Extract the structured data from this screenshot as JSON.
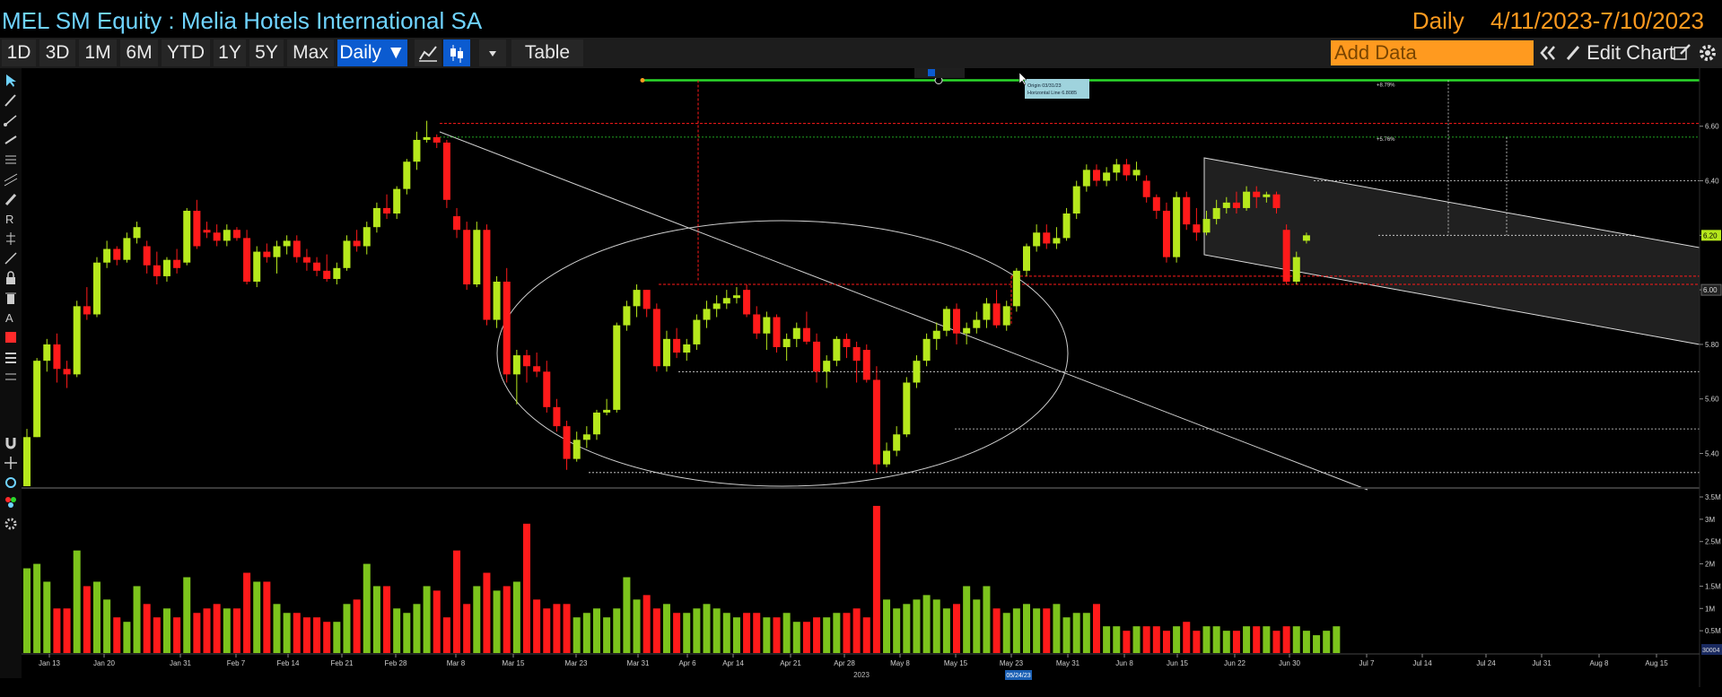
{
  "window": {
    "title": "MEL SM Equity : Melia Hotels International SA",
    "frequency": "Daily",
    "date_range": "4/11/2023-7/10/2023"
  },
  "toolbar": {
    "periods": [
      "1D",
      "3D",
      "1M",
      "6M",
      "YTD",
      "1Y",
      "5Y",
      "Max"
    ],
    "frequency_label": "Daily ▼",
    "table_label": "Table",
    "add_data_placeholder": "Add Data",
    "edit_chart_label": "Edit Chart",
    "icons": [
      "line-chart-icon",
      "candlestick-icon",
      "dropdown-icon",
      "collapse-icon",
      "pencil-icon",
      "edit-icon",
      "gear-icon"
    ]
  },
  "left_toolbar": {
    "icons": [
      "pointer-icon",
      "pencil-icon",
      "trend-line-icon",
      "ray-icon",
      "fib-icon",
      "channel-icon",
      "brush-icon",
      "text-icon",
      "measure-icon",
      "eraser-icon",
      "lock-icon",
      "trash-icon",
      "color-icon",
      "style-icon",
      "settings-icon"
    ],
    "accent": "#ff2a2a"
  },
  "annotations": {
    "tooltip": [
      "Origin 03/31/23",
      "Horizontal Line 6.8085"
    ],
    "pct_labels": [
      "+8.79%",
      "+5.76%"
    ],
    "year_label": "2023",
    "cursor_date": "05/24/23"
  },
  "chart_data": {
    "type": "candlestick",
    "colors": {
      "up": "#b6e81c",
      "down": "#ff1a1a",
      "volume_up": "#7cc41c",
      "volume_down": "#ff1a1a",
      "level_green": "#2bd92b"
    },
    "price_axis": {
      "ticks": [
        "6.60",
        "6.40",
        "6.20",
        "6.00",
        "5.80",
        "5.60",
        "5.40"
      ],
      "ylim": [
        5.28,
        6.78
      ],
      "last_price": "6.20",
      "marker": "6.00"
    },
    "volume_axis": {
      "ticks": [
        "3.5M",
        "3M",
        "2.5M",
        "2M",
        "1.5M",
        "1M",
        "0.5M"
      ],
      "ylim": [
        0,
        3.5
      ],
      "last_volume": "30004"
    },
    "x_ticks": [
      "Jan 13",
      "Jan 20",
      "Jan 31",
      "Feb 7",
      "Feb 14",
      "Feb 21",
      "Feb 28",
      "Mar 8",
      "Mar 15",
      "Mar 23",
      "Mar 31",
      "Apr 6",
      "Apr 14",
      "Apr 21",
      "Apr 28",
      "May 8",
      "May 15",
      "May 23",
      "May 31",
      "Jun 8",
      "Jun 15",
      "Jun 22",
      "Jun 30",
      "Jul 7",
      "Jul 14",
      "Jul 24",
      "Jul 31",
      "Aug 8",
      "Aug 15"
    ],
    "ohlc": [
      {
        "o": 5.28,
        "h": 5.49,
        "l": 5.28,
        "c": 5.46
      },
      {
        "o": 5.46,
        "h": 5.75,
        "l": 5.46,
        "c": 5.74
      },
      {
        "o": 5.74,
        "h": 5.82,
        "l": 5.7,
        "c": 5.8
      },
      {
        "o": 5.8,
        "h": 5.84,
        "l": 5.66,
        "c": 5.71
      },
      {
        "o": 5.71,
        "h": 5.74,
        "l": 5.64,
        "c": 5.69
      },
      {
        "o": 5.69,
        "h": 5.96,
        "l": 5.68,
        "c": 5.94
      },
      {
        "o": 5.94,
        "h": 6.01,
        "l": 5.89,
        "c": 5.91
      },
      {
        "o": 5.91,
        "h": 6.12,
        "l": 5.9,
        "c": 6.1
      },
      {
        "o": 6.1,
        "h": 6.18,
        "l": 6.08,
        "c": 6.15
      },
      {
        "o": 6.15,
        "h": 6.16,
        "l": 6.09,
        "c": 6.11
      },
      {
        "o": 6.11,
        "h": 6.21,
        "l": 6.1,
        "c": 6.19
      },
      {
        "o": 6.19,
        "h": 6.25,
        "l": 6.17,
        "c": 6.23
      },
      {
        "o": 6.16,
        "h": 6.18,
        "l": 6.06,
        "c": 6.09
      },
      {
        "o": 6.09,
        "h": 6.14,
        "l": 6.02,
        "c": 6.05
      },
      {
        "o": 6.05,
        "h": 6.12,
        "l": 6.03,
        "c": 6.11
      },
      {
        "o": 6.11,
        "h": 6.15,
        "l": 6.06,
        "c": 6.08
      },
      {
        "o": 6.1,
        "h": 6.3,
        "l": 6.09,
        "c": 6.29
      },
      {
        "o": 6.29,
        "h": 6.33,
        "l": 6.15,
        "c": 6.16
      },
      {
        "o": 6.22,
        "h": 6.25,
        "l": 6.19,
        "c": 6.21
      },
      {
        "o": 6.21,
        "h": 6.24,
        "l": 6.16,
        "c": 6.18
      },
      {
        "o": 6.18,
        "h": 6.24,
        "l": 6.16,
        "c": 6.22
      },
      {
        "o": 6.22,
        "h": 6.23,
        "l": 6.18,
        "c": 6.19
      },
      {
        "o": 6.19,
        "h": 6.22,
        "l": 6.02,
        "c": 6.03
      },
      {
        "o": 6.03,
        "h": 6.16,
        "l": 6.01,
        "c": 6.14
      },
      {
        "o": 6.14,
        "h": 6.17,
        "l": 6.1,
        "c": 6.12
      },
      {
        "o": 6.12,
        "h": 6.18,
        "l": 6.06,
        "c": 6.16
      },
      {
        "o": 6.16,
        "h": 6.2,
        "l": 6.13,
        "c": 6.18
      },
      {
        "o": 6.18,
        "h": 6.2,
        "l": 6.1,
        "c": 6.12
      },
      {
        "o": 6.12,
        "h": 6.15,
        "l": 6.07,
        "c": 6.1
      },
      {
        "o": 6.1,
        "h": 6.12,
        "l": 6.05,
        "c": 6.07
      },
      {
        "o": 6.07,
        "h": 6.13,
        "l": 6.03,
        "c": 6.04
      },
      {
        "o": 6.04,
        "h": 6.1,
        "l": 6.02,
        "c": 6.08
      },
      {
        "o": 6.08,
        "h": 6.2,
        "l": 6.07,
        "c": 6.18
      },
      {
        "o": 6.18,
        "h": 6.22,
        "l": 6.14,
        "c": 6.16
      },
      {
        "o": 6.16,
        "h": 6.25,
        "l": 6.13,
        "c": 6.23
      },
      {
        "o": 6.23,
        "h": 6.32,
        "l": 6.21,
        "c": 6.3
      },
      {
        "o": 6.3,
        "h": 6.35,
        "l": 6.26,
        "c": 6.28
      },
      {
        "o": 6.28,
        "h": 6.38,
        "l": 6.26,
        "c": 6.37
      },
      {
        "o": 6.37,
        "h": 6.48,
        "l": 6.35,
        "c": 6.47
      },
      {
        "o": 6.47,
        "h": 6.58,
        "l": 6.44,
        "c": 6.55
      },
      {
        "o": 6.55,
        "h": 6.62,
        "l": 6.54,
        "c": 6.56
      },
      {
        "o": 6.56,
        "h": 6.57,
        "l": 6.52,
        "c": 6.54
      },
      {
        "o": 6.54,
        "h": 6.55,
        "l": 6.3,
        "c": 6.33
      },
      {
        "o": 6.27,
        "h": 6.3,
        "l": 6.19,
        "c": 6.22
      },
      {
        "o": 6.22,
        "h": 6.25,
        "l": 6.0,
        "c": 6.02
      },
      {
        "o": 6.02,
        "h": 6.25,
        "l": 6.01,
        "c": 6.22
      },
      {
        "o": 6.22,
        "h": 6.24,
        "l": 5.87,
        "c": 5.89
      },
      {
        "o": 5.89,
        "h": 6.05,
        "l": 5.86,
        "c": 6.03
      },
      {
        "o": 6.03,
        "h": 6.08,
        "l": 5.66,
        "c": 5.69
      },
      {
        "o": 5.69,
        "h": 5.78,
        "l": 5.58,
        "c": 5.76
      },
      {
        "o": 5.76,
        "h": 5.78,
        "l": 5.66,
        "c": 5.72
      },
      {
        "o": 5.72,
        "h": 5.77,
        "l": 5.68,
        "c": 5.7
      },
      {
        "o": 5.7,
        "h": 5.74,
        "l": 5.55,
        "c": 5.57
      },
      {
        "o": 5.57,
        "h": 5.6,
        "l": 5.48,
        "c": 5.5
      },
      {
        "o": 5.5,
        "h": 5.52,
        "l": 5.34,
        "c": 5.38
      },
      {
        "o": 5.38,
        "h": 5.48,
        "l": 5.37,
        "c": 5.45
      },
      {
        "o": 5.45,
        "h": 5.5,
        "l": 5.42,
        "c": 5.47
      },
      {
        "o": 5.47,
        "h": 5.56,
        "l": 5.45,
        "c": 5.55
      },
      {
        "o": 5.55,
        "h": 5.6,
        "l": 5.54,
        "c": 5.56
      },
      {
        "o": 5.56,
        "h": 5.88,
        "l": 5.55,
        "c": 5.87
      },
      {
        "o": 5.87,
        "h": 5.96,
        "l": 5.85,
        "c": 5.94
      },
      {
        "o": 5.94,
        "h": 6.02,
        "l": 5.9,
        "c": 6.0
      },
      {
        "o": 6.0,
        "h": 6.0,
        "l": 5.9,
        "c": 5.93
      },
      {
        "o": 5.93,
        "h": 5.95,
        "l": 5.7,
        "c": 5.72
      },
      {
        "o": 5.72,
        "h": 5.85,
        "l": 5.7,
        "c": 5.82
      },
      {
        "o": 5.82,
        "h": 5.86,
        "l": 5.75,
        "c": 5.77
      },
      {
        "o": 5.77,
        "h": 5.82,
        "l": 5.74,
        "c": 5.8
      },
      {
        "o": 5.8,
        "h": 5.91,
        "l": 5.78,
        "c": 5.89
      },
      {
        "o": 5.89,
        "h": 5.96,
        "l": 5.86,
        "c": 5.93
      },
      {
        "o": 5.93,
        "h": 5.98,
        "l": 5.9,
        "c": 5.95
      },
      {
        "o": 5.95,
        "h": 6.0,
        "l": 5.93,
        "c": 5.97
      },
      {
        "o": 5.97,
        "h": 6.01,
        "l": 5.95,
        "c": 5.98
      },
      {
        "o": 6.0,
        "h": 6.02,
        "l": 5.9,
        "c": 5.91
      },
      {
        "o": 5.91,
        "h": 5.94,
        "l": 5.82,
        "c": 5.84
      },
      {
        "o": 5.84,
        "h": 5.92,
        "l": 5.78,
        "c": 5.9
      },
      {
        "o": 5.9,
        "h": 5.91,
        "l": 5.77,
        "c": 5.79
      },
      {
        "o": 5.79,
        "h": 5.84,
        "l": 5.74,
        "c": 5.82
      },
      {
        "o": 5.82,
        "h": 5.88,
        "l": 5.79,
        "c": 5.86
      },
      {
        "o": 5.86,
        "h": 5.92,
        "l": 5.8,
        "c": 5.81
      },
      {
        "o": 5.81,
        "h": 5.84,
        "l": 5.66,
        "c": 5.7
      },
      {
        "o": 5.7,
        "h": 5.76,
        "l": 5.64,
        "c": 5.74
      },
      {
        "o": 5.74,
        "h": 5.83,
        "l": 5.72,
        "c": 5.82
      },
      {
        "o": 5.82,
        "h": 5.84,
        "l": 5.75,
        "c": 5.79
      },
      {
        "o": 5.79,
        "h": 5.81,
        "l": 5.66,
        "c": 5.74
      },
      {
        "o": 5.78,
        "h": 5.8,
        "l": 5.66,
        "c": 5.67
      },
      {
        "o": 5.67,
        "h": 5.72,
        "l": 5.33,
        "c": 5.36
      },
      {
        "o": 5.36,
        "h": 5.44,
        "l": 5.35,
        "c": 5.41
      },
      {
        "o": 5.41,
        "h": 5.5,
        "l": 5.39,
        "c": 5.47
      },
      {
        "o": 5.47,
        "h": 5.68,
        "l": 5.46,
        "c": 5.66
      },
      {
        "o": 5.66,
        "h": 5.76,
        "l": 5.64,
        "c": 5.74
      },
      {
        "o": 5.74,
        "h": 5.84,
        "l": 5.72,
        "c": 5.82
      },
      {
        "o": 5.82,
        "h": 5.88,
        "l": 5.78,
        "c": 5.85
      },
      {
        "o": 5.85,
        "h": 5.94,
        "l": 5.83,
        "c": 5.93
      },
      {
        "o": 5.93,
        "h": 5.95,
        "l": 5.8,
        "c": 5.84
      },
      {
        "o": 5.84,
        "h": 5.88,
        "l": 5.8,
        "c": 5.86
      },
      {
        "o": 5.86,
        "h": 5.92,
        "l": 5.84,
        "c": 5.89
      },
      {
        "o": 5.89,
        "h": 5.97,
        "l": 5.86,
        "c": 5.95
      },
      {
        "o": 5.95,
        "h": 6.0,
        "l": 5.86,
        "c": 5.87
      },
      {
        "o": 5.87,
        "h": 5.96,
        "l": 5.85,
        "c": 5.94
      },
      {
        "o": 5.94,
        "h": 6.08,
        "l": 5.92,
        "c": 6.07
      },
      {
        "o": 6.07,
        "h": 6.17,
        "l": 6.05,
        "c": 6.16
      },
      {
        "o": 6.16,
        "h": 6.24,
        "l": 6.14,
        "c": 6.21
      },
      {
        "o": 6.21,
        "h": 6.24,
        "l": 6.15,
        "c": 6.17
      },
      {
        "o": 6.17,
        "h": 6.23,
        "l": 6.15,
        "c": 6.19
      },
      {
        "o": 6.19,
        "h": 6.3,
        "l": 6.18,
        "c": 6.28
      },
      {
        "o": 6.28,
        "h": 6.4,
        "l": 6.26,
        "c": 6.38
      },
      {
        "o": 6.38,
        "h": 6.46,
        "l": 6.36,
        "c": 6.44
      },
      {
        "o": 6.44,
        "h": 6.46,
        "l": 6.38,
        "c": 6.4
      },
      {
        "o": 6.4,
        "h": 6.45,
        "l": 6.38,
        "c": 6.43
      },
      {
        "o": 6.43,
        "h": 6.48,
        "l": 6.4,
        "c": 6.46
      },
      {
        "o": 6.46,
        "h": 6.48,
        "l": 6.4,
        "c": 6.42
      },
      {
        "o": 6.42,
        "h": 6.47,
        "l": 6.4,
        "c": 6.44
      },
      {
        "o": 6.4,
        "h": 6.42,
        "l": 6.32,
        "c": 6.34
      },
      {
        "o": 6.34,
        "h": 6.35,
        "l": 6.26,
        "c": 6.29
      },
      {
        "o": 6.29,
        "h": 6.32,
        "l": 6.1,
        "c": 6.12
      },
      {
        "o": 6.12,
        "h": 6.36,
        "l": 6.1,
        "c": 6.34
      },
      {
        "o": 6.34,
        "h": 6.36,
        "l": 6.22,
        "c": 6.24
      },
      {
        "o": 6.24,
        "h": 6.3,
        "l": 6.18,
        "c": 6.21
      },
      {
        "o": 6.21,
        "h": 6.29,
        "l": 6.2,
        "c": 6.26
      },
      {
        "o": 6.26,
        "h": 6.33,
        "l": 6.24,
        "c": 6.3
      },
      {
        "o": 6.3,
        "h": 6.34,
        "l": 6.28,
        "c": 6.32
      },
      {
        "o": 6.32,
        "h": 6.36,
        "l": 6.28,
        "c": 6.3
      },
      {
        "o": 6.3,
        "h": 6.38,
        "l": 6.29,
        "c": 6.36
      },
      {
        "o": 6.36,
        "h": 6.38,
        "l": 6.3,
        "c": 6.34
      },
      {
        "o": 6.34,
        "h": 6.36,
        "l": 6.32,
        "c": 6.35
      },
      {
        "o": 6.35,
        "h": 6.36,
        "l": 6.28,
        "c": 6.3
      },
      {
        "o": 6.22,
        "h": 6.24,
        "l": 6.02,
        "c": 6.03
      },
      {
        "o": 6.03,
        "h": 6.14,
        "l": 6.02,
        "c": 6.12
      },
      {
        "o": 6.18,
        "h": 6.21,
        "l": 6.17,
        "c": 6.2
      }
    ],
    "volume": [
      1.9,
      2.0,
      1.6,
      1.0,
      1.0,
      2.3,
      1.5,
      1.6,
      1.2,
      0.8,
      0.7,
      1.5,
      1.1,
      0.8,
      1.0,
      0.8,
      1.7,
      0.9,
      1.0,
      1.1,
      1.0,
      1.0,
      1.8,
      1.6,
      1.6,
      1.1,
      0.9,
      0.9,
      0.8,
      0.8,
      0.7,
      0.7,
      1.1,
      1.2,
      2.0,
      1.5,
      1.5,
      1.0,
      0.9,
      1.1,
      1.5,
      1.4,
      0.8,
      2.3,
      1.1,
      1.5,
      1.8,
      1.4,
      1.5,
      1.6,
      2.9,
      1.2,
      1.0,
      1.1,
      1.1,
      0.8,
      0.9,
      1.0,
      0.8,
      1.0,
      1.7,
      1.2,
      1.3,
      1.0,
      1.1,
      0.9,
      0.9,
      1.0,
      1.1,
      1.0,
      0.9,
      0.8,
      0.9,
      0.9,
      0.8,
      0.8,
      0.9,
      0.7,
      0.7,
      0.8,
      0.8,
      0.9,
      0.9,
      1.0,
      0.8,
      3.3,
      1.2,
      1.0,
      1.1,
      1.2,
      1.3,
      1.2,
      1.0,
      1.1,
      1.5,
      1.2,
      1.5,
      1.0,
      0.9,
      1.0,
      1.1,
      1.0,
      1.0,
      1.1,
      0.8,
      0.9,
      0.9,
      1.1,
      0.6,
      0.6,
      0.5,
      0.6,
      0.6,
      0.6,
      0.5,
      0.6,
      0.7,
      0.5,
      0.6,
      0.6,
      0.5,
      0.5,
      0.6,
      0.6,
      0.6,
      0.5,
      0.6,
      0.6,
      0.5,
      0.4,
      0.5,
      0.6
    ],
    "drawn_levels": {
      "horizontal_green": 6.7685,
      "red_resistance": 6.61,
      "dotted_supports": [
        5.7,
        5.49,
        5.33
      ],
      "red_box_top": 6.05,
      "red_box_bottom": 6.02
    }
  }
}
